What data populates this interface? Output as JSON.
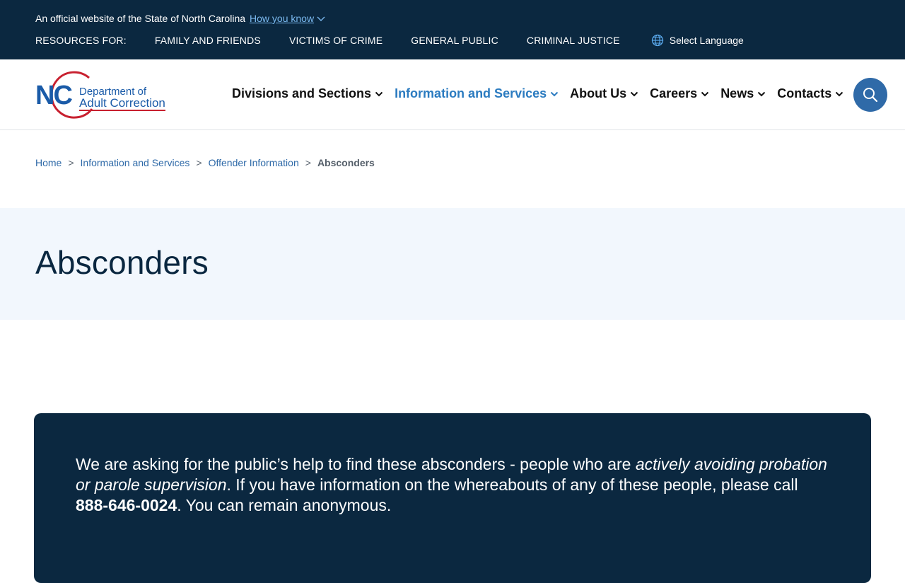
{
  "topbar": {
    "official_text": "An official website of the State of North Carolina",
    "how_you_know": "How you know",
    "resources_label": "RESOURCES FOR:",
    "resources": [
      "FAMILY AND FRIENDS",
      "VICTIMS OF CRIME",
      "GENERAL PUBLIC",
      "CRIMINAL JUSTICE"
    ],
    "language_label": "Select Language"
  },
  "logo": {
    "mark": "NC",
    "line1": "Department of",
    "line2": "Adult Correction"
  },
  "nav": {
    "items": [
      {
        "label": "Divisions and Sections",
        "icon": "chevron-down-icon"
      },
      {
        "label": "Information and Services",
        "icon": "chevron-down-icon"
      },
      {
        "label": "About Us",
        "icon": "chevron-down-icon"
      },
      {
        "label": "Careers",
        "icon": "chevron-down-icon"
      },
      {
        "label": "News",
        "icon": "chevron-down-icon"
      },
      {
        "label": "Contacts",
        "icon": "chevron-down-icon"
      }
    ],
    "active_index": 1,
    "search_icon": "search-icon"
  },
  "breadcrumb": {
    "items": [
      "Home",
      "Information and Services",
      "Offender Information"
    ],
    "current": "Absconders"
  },
  "page": {
    "title": "Absconders"
  },
  "notice": {
    "part1": "We are asking for the public’s help to find these absconders - people who are ",
    "emphasis": "actively avoiding probation or parole supervision",
    "part2": ". If you have information on the whereabouts of any of these people, please call ",
    "phone": "888-646-0024",
    "part3": ". You can remain anonymous."
  },
  "colors": {
    "navy": "#0b2840",
    "accent_blue": "#2b7bc0",
    "hero_bg": "#f2f7fd",
    "logo_red": "#c8202f"
  }
}
